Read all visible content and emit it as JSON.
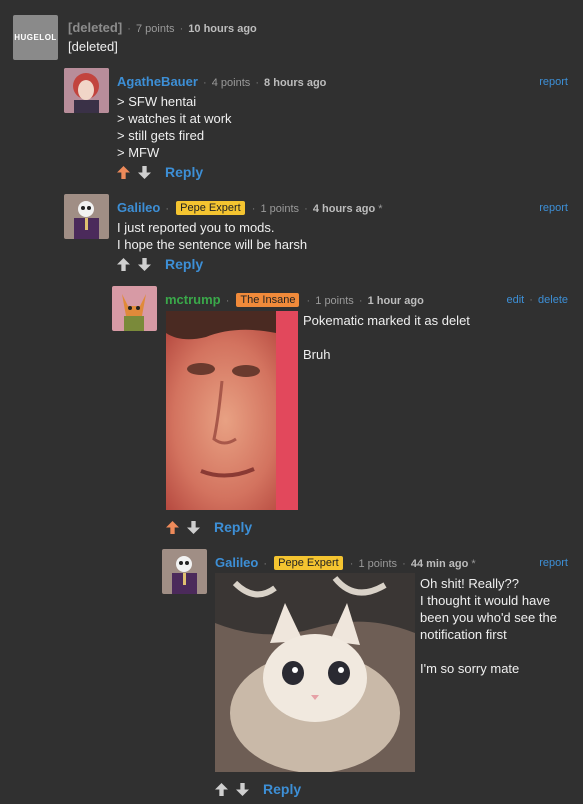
{
  "comments": [
    {
      "author": "[deleted]",
      "points": "7 points",
      "time": "10 hours ago",
      "edited": "",
      "flair": "",
      "body": "[deleted]",
      "avatar_text": "HUGELOL",
      "right_link": ""
    },
    {
      "author": "AgatheBauer",
      "points": "4 points",
      "time": "8 hours ago",
      "edited": "",
      "flair": "",
      "body": "> SFW hentai\n> watches it at work\n> still gets fired\n> MFW",
      "right_link": "report",
      "reply": "Reply"
    },
    {
      "author": "Galileo",
      "flair": "Pepe Expert",
      "points": "1 points",
      "time": "4 hours ago",
      "edited": "*",
      "body": "I just reported you to mods.\nI hope the sentence will be harsh",
      "right_link": "report",
      "reply": "Reply"
    },
    {
      "author": "mctrump",
      "flair": "The Insane",
      "points": "1 points",
      "time": "1 hour ago",
      "edited": "",
      "body": "Pokematic marked it as delet\n\nBruh",
      "right_edit": "edit",
      "right_delete": "delete",
      "reply": "Reply"
    },
    {
      "author": "Galileo",
      "flair": "Pepe Expert",
      "points": "1 points",
      "time": "44 min ago",
      "edited": "*",
      "body": "Oh shit! Really??\nI thought it would have\nbeen you who'd see the\nnotification first\n\nI'm so sorry mate",
      "right_link": "report",
      "reply": "Reply"
    }
  ],
  "colors": {
    "background": "#303030",
    "link": "#3d8fd6",
    "upvote_active": "#ee8a5a",
    "pepe_flair": "#f4c430",
    "insane_flair": "#f08a3a"
  }
}
